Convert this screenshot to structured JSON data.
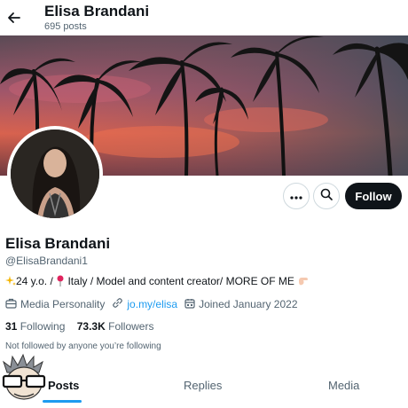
{
  "header": {
    "title": "Elisa Brandani",
    "subtitle": "695 posts"
  },
  "profile": {
    "name": "Elisa Brandani",
    "handle": "@ElisaBrandani1",
    "bio_text_1": "24 y.o. / ",
    "bio_text_2": " Italy / Model and content creator/ MORE OF ME ",
    "category": "Media Personality",
    "website": "jo.my/elisa",
    "joined": "Joined January 2022",
    "following_count": "31",
    "following_label": "Following",
    "followers_count": "73.3K",
    "followers_label": "Followers",
    "not_followed_text": "Not followed by anyone you’re following"
  },
  "actions": {
    "follow_label": "Follow"
  },
  "tabs": [
    {
      "label": "Posts",
      "active": true
    },
    {
      "label": "Replies",
      "active": false
    },
    {
      "label": "Media",
      "active": false
    }
  ],
  "colors": {
    "accent": "#1d9bf0",
    "text": "#0f1419",
    "muted": "#536471",
    "button_dark": "#0f1419"
  },
  "icons": [
    "back-arrow-icon",
    "more-icon",
    "search-icon",
    "sparkle-icon",
    "pin-icon",
    "hand-icon",
    "briefcase-icon",
    "link-icon",
    "calendar-icon"
  ]
}
